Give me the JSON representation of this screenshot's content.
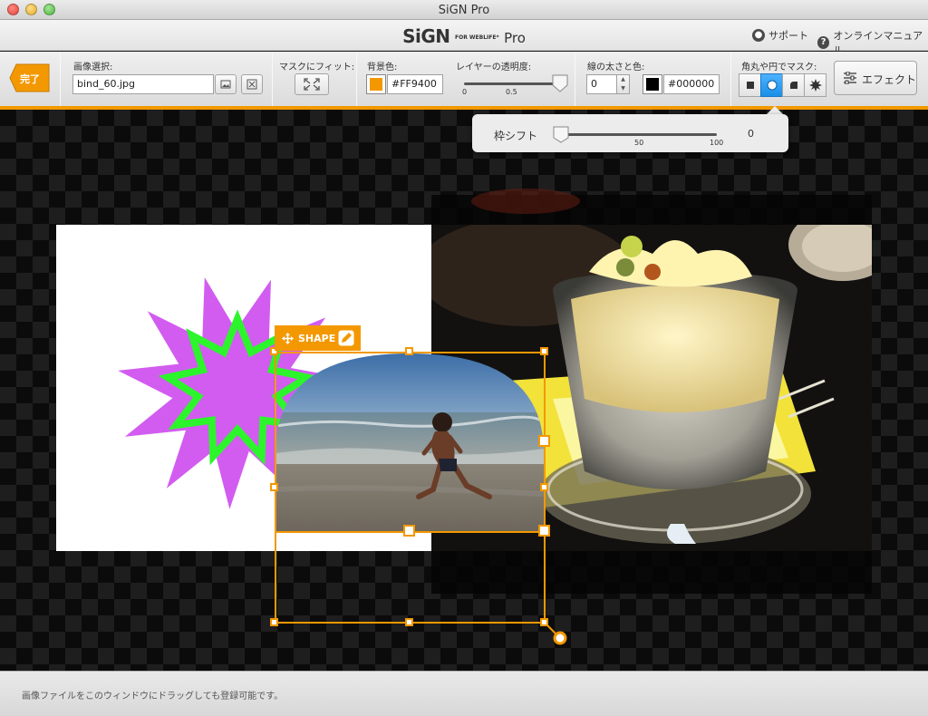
{
  "window": {
    "title": "SiGN Pro"
  },
  "brand": {
    "main": "SiGN",
    "small": "FOR WEBLIFE*",
    "pro": "Pro"
  },
  "top_links": {
    "support": "サポート",
    "manual": "オンラインマニュアル"
  },
  "toolbar": {
    "done_label": "完了",
    "image_select_label": "画像選択:",
    "image_file_value": "bind_60.jpg",
    "fit_mask_label": "マスクにフィット:",
    "bg_color_label": "背景色:",
    "bg_color_value": "#FF9400",
    "opacity_label": "レイヤーの透明度:",
    "opacity_tick_min": "0",
    "opacity_tick_mid": "0.5",
    "opacity_value": 1.0,
    "border_label": "線の太さと色:",
    "border_width_value": "0",
    "border_color_value": "#000000",
    "mask_label": "角丸や円でマスク:",
    "mask_options": [
      "square",
      "circle",
      "rounded-corner",
      "starburst"
    ],
    "mask_selected": "circle",
    "effect_label": "エフェクト"
  },
  "popover": {
    "label": "枠シフト",
    "tick_mid": "50",
    "tick_max": "100",
    "value": "0"
  },
  "shape_tag": {
    "label": "SHAPE"
  },
  "status": {
    "hint": "画像ファイルをこのウィンドウにドラッグしても登録可能です。"
  },
  "colors": {
    "accent": "#f39800",
    "mask_active": "#1a8fe8",
    "star_purple": "#d25cf0",
    "star_green": "#2cf52c"
  }
}
